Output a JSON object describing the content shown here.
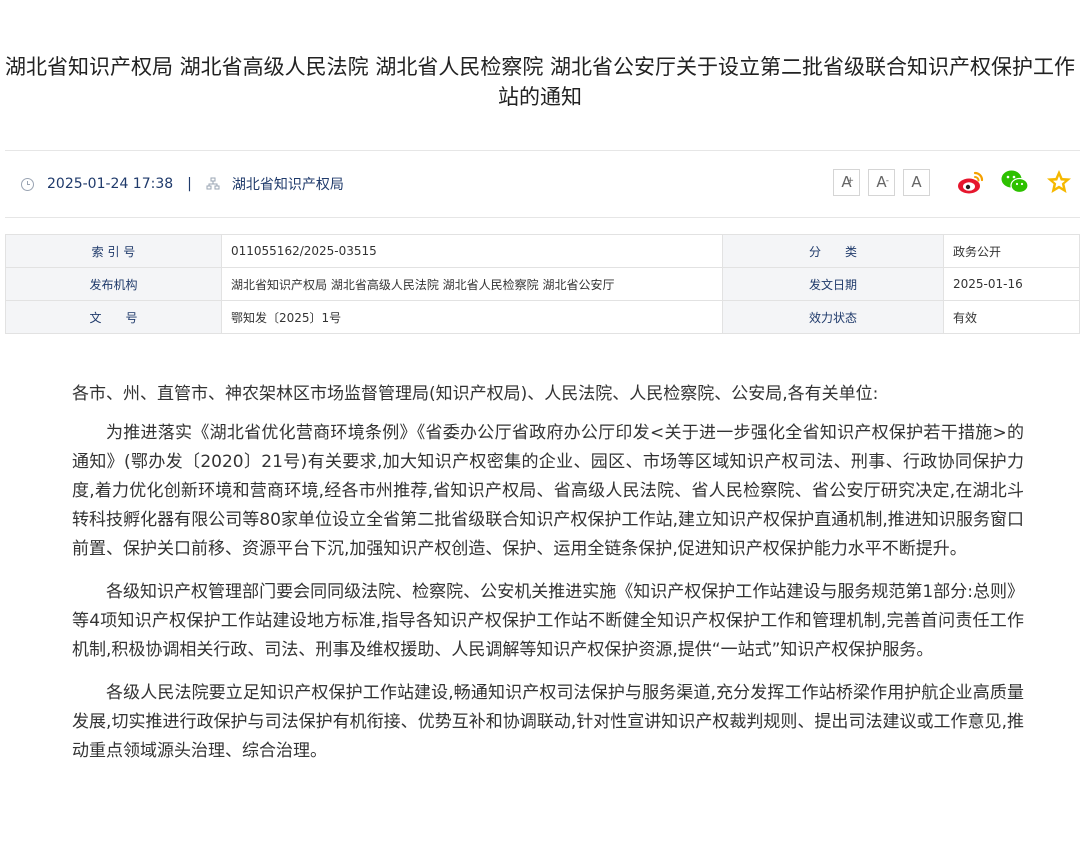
{
  "article": {
    "title": "湖北省知识产权局 湖北省高级人民法院 湖北省人民检察院 湖北省公安厅关于设立第二批省级联合知识产权保护工作站的通知"
  },
  "meta": {
    "datetime": "2025-01-24 17:38",
    "separator": "|",
    "source": "湖北省知识产权局",
    "font_large": "A",
    "font_large_sup": "+",
    "font_small": "A",
    "font_small_sup": "-",
    "font_default": "A",
    "share_icons": [
      "weibo-icon",
      "wechat-icon",
      "favorite-star-icon"
    ],
    "colors": {
      "weibo": "#e6162d",
      "wechat": "#2dc100",
      "star": "#f5b800"
    }
  },
  "info": {
    "index_label": "索 引 号",
    "index_value": "011055162/2025-03515",
    "category_label": "分　　类",
    "category_value": "政务公开",
    "issuer_label": "发布机构",
    "issuer_value": "湖北省知识产权局 湖北省高级人民法院 湖北省人民检察院 湖北省公安厅",
    "date_label": "发文日期",
    "date_value": "2025-01-16",
    "docno_label": "文　　号",
    "docno_value": "鄂知发〔2025〕1号",
    "status_label": "效力状态",
    "status_value": "有效"
  },
  "body": {
    "salutation": "各市、州、直管市、神农架林区市场监督管理局(知识产权局)、人民法院、人民检察院、公安局,各有关单位:",
    "p1": "为推进落实《湖北省优化营商环境条例》《省委办公厅省政府办公厅印发<关于进一步强化全省知识产权保护若干措施>的通知》(鄂办发〔2020〕21号)有关要求,加大知识产权密集的企业、园区、市场等区域知识产权司法、刑事、行政协同保护力度,着力优化创新环境和营商环境,经各市州推荐,省知识产权局、省高级人民法院、省人民检察院、省公安厅研究决定,在湖北斗转科技孵化器有限公司等80家单位设立全省第二批省级联合知识产权保护工作站,建立知识产权保护直通机制,推进知识服务窗口前置、保护关口前移、资源平台下沉,加强知识产权创造、保护、运用全链条保护,促进知识产权保护能力水平不断提升。",
    "p2": "各级知识产权管理部门要会同同级法院、检察院、公安机关推进实施《知识产权保护工作站建设与服务规范第1部分:总则》等4项知识产权保护工作站建设地方标准,指导各知识产权保护工作站不断健全知识产权保护工作和管理机制,完善首问责任工作机制,积极协调相关行政、司法、刑事及维权援助、人民调解等知识产权保护资源,提供“一站式”知识产权保护服务。",
    "p3": "各级人民法院要立足知识产权保护工作站建设,畅通知识产权司法保护与服务渠道,充分发挥工作站桥梁作用护航企业高质量发展,切实推进行政保护与司法保护有机衔接、优势互补和协调联动,针对性宣讲知识产权裁判规则、提出司法建议或工作意见,推动重点领域源头治理、综合治理。"
  }
}
